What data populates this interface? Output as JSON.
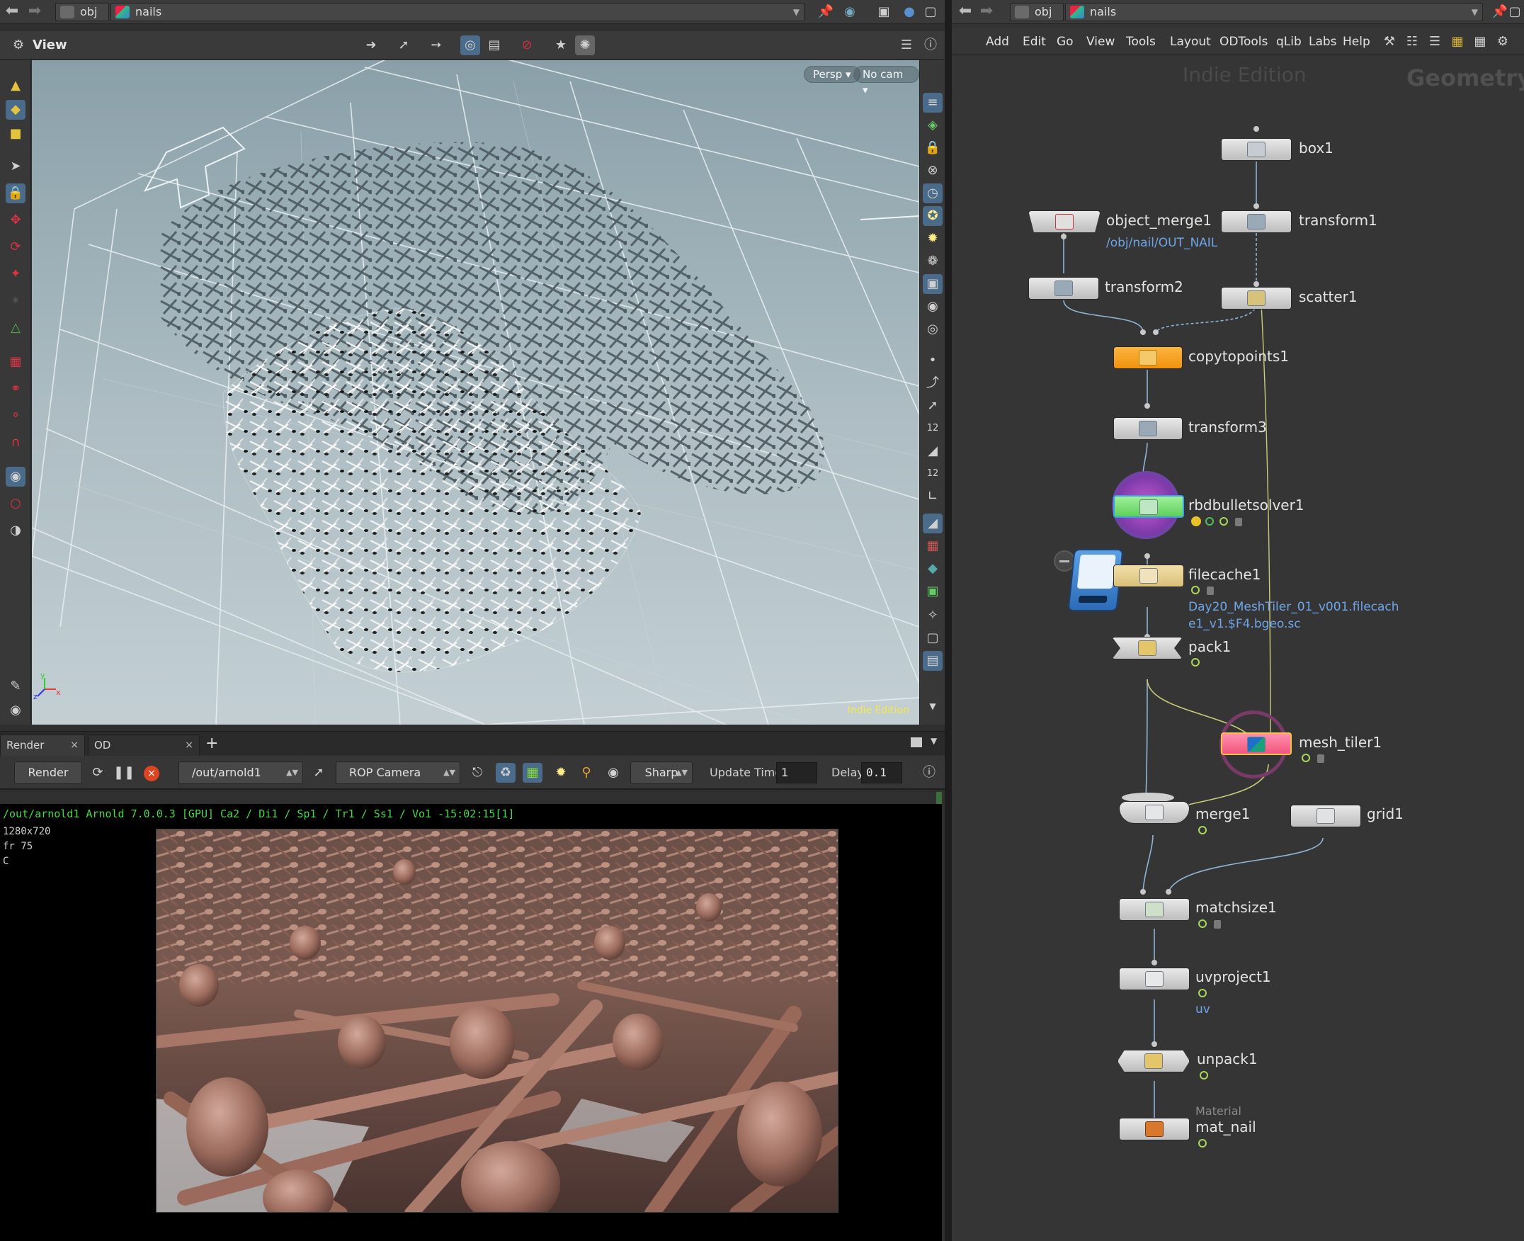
{
  "left_pane": {
    "path": {
      "crumbs": [
        "obj",
        "nails"
      ]
    },
    "view": {
      "title": "View",
      "camera_menu": "Persp",
      "cam_menu": "No cam",
      "edition_watermark": "Indie Edition"
    },
    "tabs": [
      {
        "label": "Render View"
      },
      {
        "label": "OD ProjectSelector"
      }
    ],
    "add_tab": "+",
    "render_toolbar": {
      "render_label": "Render",
      "rop_path": "/out/arnold1",
      "camera": "ROP Camera",
      "sharpness": "Sharp",
      "update_time_label": "Update Time",
      "update_time_value": "1",
      "delay_label": "Delay",
      "delay_value": "0.1"
    },
    "render_info": "/out/arnold1   Arnold 7.0.0.3 [GPU]  Ca2 / Di1 / Sp1 / Tr1 / Ss1 / Vo1 -15:02:15[1]",
    "render_meta": [
      "1280x720",
      "fr 75",
      "C"
    ]
  },
  "right_pane": {
    "path": {
      "crumbs": [
        "obj",
        "nails"
      ]
    },
    "menu": [
      "Add",
      "Edit",
      "Go",
      "View",
      "Tools",
      "Layout",
      "ODTools",
      "qLib",
      "Labs",
      "Help"
    ],
    "watermark_edition": "Indie Edition",
    "watermark_context": "Geometry",
    "nodes": {
      "box1": "box1",
      "object_merge1": "object_merge1",
      "object_merge1_sub": "/obj/nail/OUT_NAIL",
      "transform1": "transform1",
      "transform2": "transform2",
      "scatter1": "scatter1",
      "copytopoints1": "copytopoints1",
      "transform3": "transform3",
      "rbdbulletsolver1": "rbdbulletsolver1",
      "filecache1": "filecache1",
      "filecache1_sub1": "Day20_MeshTiler_01_v001.filecach",
      "filecache1_sub2": "e1_v1.$F4.bgeo.sc",
      "pack1": "pack1",
      "mesh_tiler1": "mesh_tiler1",
      "merge1": "merge1",
      "grid1": "grid1",
      "matchsize1": "matchsize1",
      "uvproject1": "uvproject1",
      "uvproject1_sub": "uv",
      "unpack1": "unpack1",
      "mat_nail_type": "Material",
      "mat_nail": "mat_nail"
    }
  }
}
